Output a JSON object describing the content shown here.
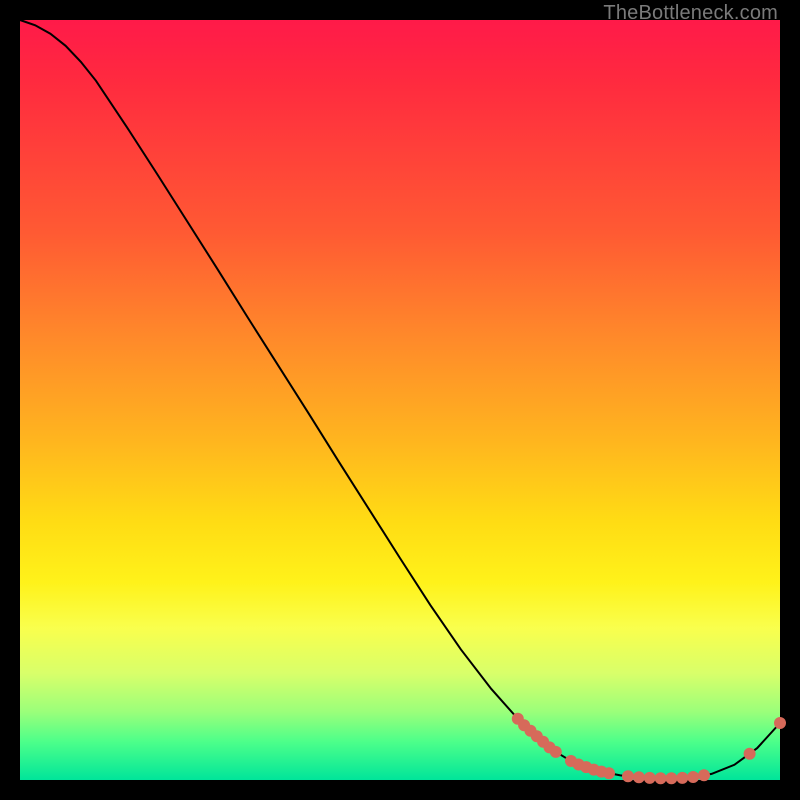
{
  "attribution": "TheBottleneck.com",
  "colors": {
    "curve": "#000000",
    "dots": "#d66a5a",
    "gradient_stops": [
      "#ff1a49",
      "#ff2a3f",
      "#ff5a33",
      "#ff8a2a",
      "#ffb41f",
      "#ffdc14",
      "#fff21a",
      "#f9ff4d",
      "#d8ff6a",
      "#9bff7a",
      "#4cff8a",
      "#00e59a"
    ]
  },
  "chart_data": {
    "type": "line",
    "title": "",
    "xlabel": "",
    "ylabel": "",
    "xlim": [
      0,
      1
    ],
    "ylim": [
      0,
      1
    ],
    "x": [
      0.0,
      0.02,
      0.04,
      0.06,
      0.08,
      0.1,
      0.14,
      0.18,
      0.22,
      0.26,
      0.3,
      0.34,
      0.38,
      0.42,
      0.46,
      0.5,
      0.54,
      0.58,
      0.62,
      0.66,
      0.7,
      0.73,
      0.76,
      0.79,
      0.82,
      0.85,
      0.88,
      0.91,
      0.94,
      0.97,
      1.0
    ],
    "values": [
      1.0,
      0.993,
      0.982,
      0.966,
      0.945,
      0.92,
      0.86,
      0.798,
      0.735,
      0.672,
      0.608,
      0.545,
      0.482,
      0.418,
      0.355,
      0.292,
      0.23,
      0.172,
      0.12,
      0.075,
      0.04,
      0.022,
      0.012,
      0.006,
      0.003,
      0.002,
      0.003,
      0.008,
      0.02,
      0.042,
      0.075
    ],
    "dot_clusters": [
      {
        "x_start": 0.655,
        "x_end": 0.705,
        "count": 7
      },
      {
        "x_start": 0.725,
        "x_end": 0.775,
        "count": 6
      },
      {
        "x_start": 0.8,
        "x_end": 0.9,
        "count": 8
      },
      {
        "x_start": 0.955,
        "x_end": 0.965,
        "count": 1
      },
      {
        "x_start": 0.995,
        "x_end": 1.005,
        "count": 1
      }
    ],
    "dot_radius_px": 6
  }
}
